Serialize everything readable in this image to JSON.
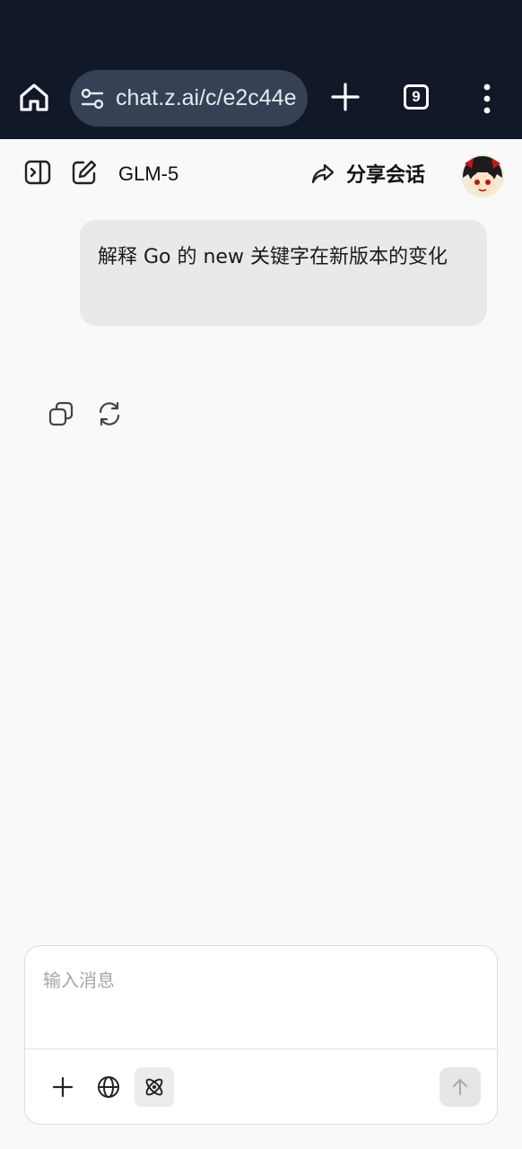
{
  "browser": {
    "url": "chat.z.ai/c/e2c44e",
    "tab_count": "9",
    "icons": {
      "home": "home-icon",
      "site_settings": "site-settings-icon",
      "new_tab": "plus-icon",
      "tabs": "tab-switcher-icon",
      "menu": "more-vert-icon"
    }
  },
  "header": {
    "model_name": "GLM-5",
    "share_label": "分享会话",
    "icons": {
      "sidebar": "sidebar-toggle-icon",
      "new_chat": "edit-icon",
      "share": "share-arrow-icon",
      "avatar": "avatar"
    }
  },
  "conversation": {
    "user_message": " 解释 Go 的 new 关键字在新版本的变化",
    "actions": [
      "copy-icon",
      "regenerate-icon"
    ]
  },
  "composer": {
    "placeholder": "输入消息",
    "value": "",
    "tools": [
      "plus-icon",
      "globe-icon",
      "atom-icon"
    ],
    "send": "send-arrow-icon"
  },
  "colors": {
    "chrome_bg": "#111827",
    "url_pill_bg": "#364155",
    "page_bg": "#f9f9f9",
    "bubble_bg": "#e9e9e9"
  }
}
